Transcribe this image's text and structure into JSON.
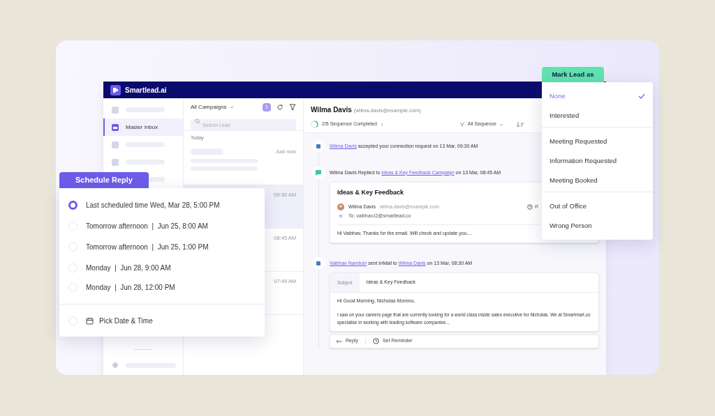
{
  "app": {
    "logo_text": "Smartlead.ai"
  },
  "sidebar": {
    "items": [
      {
        "kind": "placeholder",
        "selected": false
      },
      {
        "kind": "label",
        "label": "Master Inbox",
        "selected": true
      },
      {
        "kind": "placeholder",
        "selected": false
      },
      {
        "kind": "placeholder",
        "selected": false
      },
      {
        "kind": "placeholder",
        "selected": false
      }
    ],
    "footer": {
      "kind": "placeholder"
    }
  },
  "lead_list": {
    "filter": "All Campaigns",
    "count": "1",
    "search_placeholder": "Search Lead",
    "group": "Today",
    "items": [
      {
        "time": "Just now",
        "selected": false
      },
      {
        "time": "09:30 AM",
        "selected": true
      },
      {
        "time": "08:45 AM",
        "selected": false
      },
      {
        "time": "07:48 AM",
        "selected": false
      }
    ]
  },
  "lead": {
    "name": "Wilma Davis",
    "email": "(wilma.davis@example.com)",
    "progress": "2/5 Sequence Completed",
    "sequence_filter": "All Sequence"
  },
  "timeline": [
    {
      "kind": "connection",
      "parts": [
        {
          "text": "Wilma Davis",
          "link": true
        },
        {
          "text": " accepted your connection request on 13 Mar, 09:30 AM",
          "link": false
        }
      ]
    },
    {
      "kind": "reply",
      "parts": [
        {
          "text": "Wilma Davis Replied to ",
          "link": false
        },
        {
          "text": "Ideas & Key Feedback Campaign",
          "link": true
        },
        {
          "text": " on 13 Mar, 08:45 AM",
          "link": false
        }
      ],
      "card": {
        "title": "Ideas & Key Feedback",
        "sender": "Wilma Davis",
        "sender_email": "wilma.davis@example.com",
        "side": "R",
        "to": "To: vaibhav.l2@smartlead.co",
        "body": "Hi Vaibhav, Thanks for the email. Will check and update you...."
      }
    },
    {
      "kind": "inmail",
      "parts": [
        {
          "text": "Vaibhav Namburi",
          "link": true
        },
        {
          "text": " sent InMail to ",
          "link": false
        },
        {
          "text": "Wilma Davis",
          "link": true
        },
        {
          "text": " on 13 Mar, 08:30 AM",
          "link": false
        }
      ],
      "card": {
        "subject_label": "Subject",
        "subject": "Ideas & Key Feedback",
        "greeting": "Hi Good Morning, Nicholas Moreno,",
        "body": "I saw on your careers page that are currently looking for a world class inside sales executive for Nicholas. We at Smartmart.co specialise in working with leading software companies...",
        "actions": [
          {
            "kind": "reply",
            "label": "Reply"
          },
          {
            "kind": "reminder",
            "label": "Set Reminder"
          }
        ]
      }
    }
  ],
  "schedule_reply": {
    "title": "Schedule Reply",
    "options": [
      {
        "text": "Last scheduled time Wed, Mar 28, 5:00 PM",
        "selected": true
      },
      {
        "text": "Tomorrow afternoon  |  Jun 25, 8:00 AM",
        "selected": false
      },
      {
        "text": "Tomorrow afternoon  |  Jun 25, 1:00 PM",
        "selected": false
      },
      {
        "text": "Monday  |  Jun 28, 9:00 AM",
        "selected": false
      },
      {
        "text": "Monday  |  Jun 28, 12:00 PM",
        "selected": false
      }
    ],
    "custom": {
      "label": "Pick Date & Time",
      "selected": false
    }
  },
  "mark_lead": {
    "title": "Mark Lead as",
    "groups": [
      {
        "items": [
          {
            "label": "None",
            "selected": true
          },
          {
            "label": "Interested",
            "selected": false
          }
        ]
      },
      {
        "items": [
          {
            "label": "Meeting Requested",
            "selected": false
          },
          {
            "label": "Information Requested",
            "selected": false
          },
          {
            "label": "Meeting Booked",
            "selected": false
          }
        ]
      },
      {
        "items": [
          {
            "label": "Out of Office",
            "selected": false
          },
          {
            "label": "Wrong Person",
            "selected": false
          }
        ]
      }
    ]
  }
}
